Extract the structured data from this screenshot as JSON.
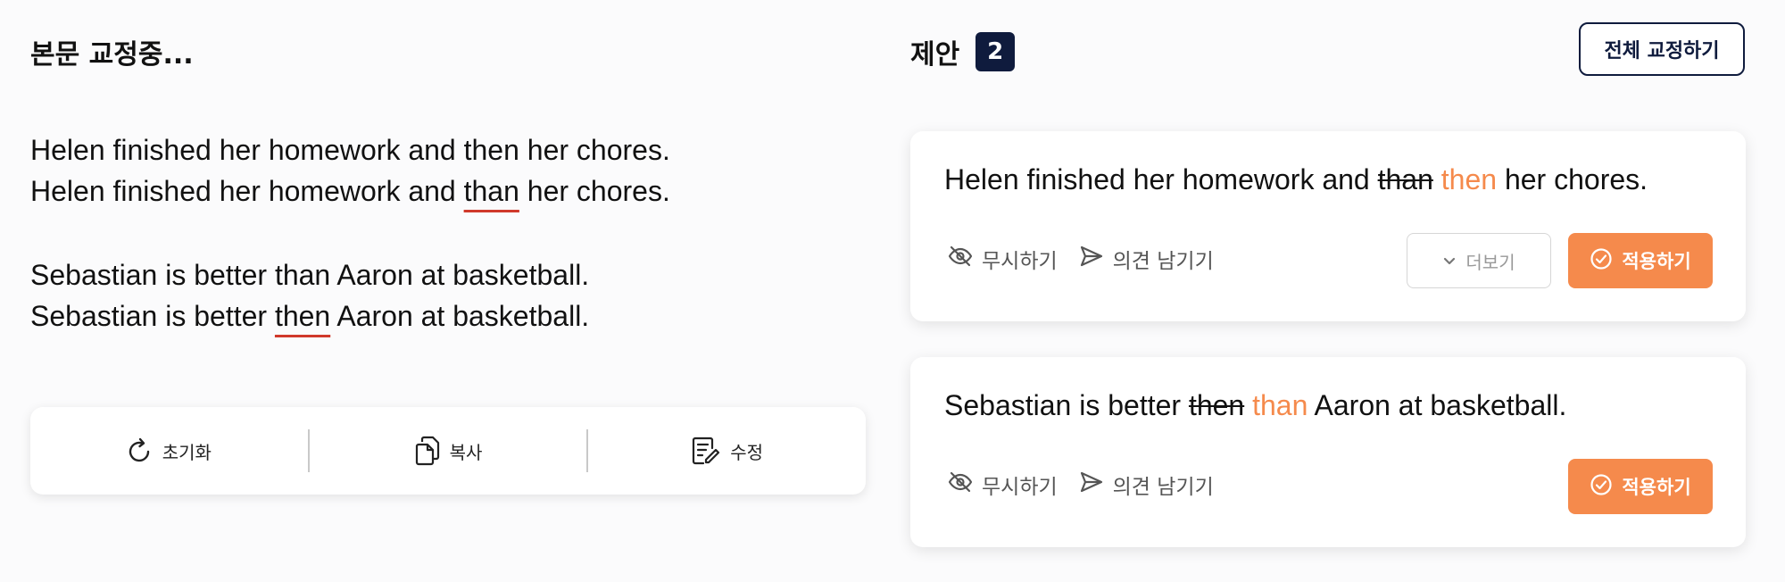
{
  "left": {
    "title": "본문 교정중...",
    "paragraphs": [
      {
        "line1": "Helen finished her homework and then her chores.",
        "line2_before": "Helen finished her homework and ",
        "line2_error": "than",
        "line2_after": " her chores."
      },
      {
        "line1": "Sebastian is better than Aaron at basketball.",
        "line2_before": "Sebastian is better ",
        "line2_error": "then",
        "line2_after": " Aaron at basketball."
      }
    ],
    "toolbar": {
      "reset_label": "초기화",
      "copy_label": "복사",
      "edit_label": "수정"
    }
  },
  "right": {
    "title": "제안",
    "count": "2",
    "fix_all_label": "전체 교정하기",
    "cards": [
      {
        "before": "Helen finished her homework and ",
        "removed": "than",
        "added": "then",
        "after": " her chores.",
        "ignore_label": "무시하기",
        "feedback_label": "의견 남기기",
        "more_label": "더보기",
        "apply_label": "적용하기"
      },
      {
        "before": "Sebastian is better ",
        "removed": "then",
        "added": "than",
        "after": " Aaron at basketball.",
        "ignore_label": "무시하기",
        "feedback_label": "의견 남기기",
        "apply_label": "적용하기"
      }
    ]
  },
  "colors": {
    "accent": "#f58a4c",
    "navy": "#0f1b3d",
    "error_underline": "#d0392b"
  },
  "icons": [
    "reset-icon",
    "copy-icon",
    "edit-icon",
    "eye-off-icon",
    "send-icon",
    "chevron-down-icon",
    "check-circle-icon"
  ]
}
